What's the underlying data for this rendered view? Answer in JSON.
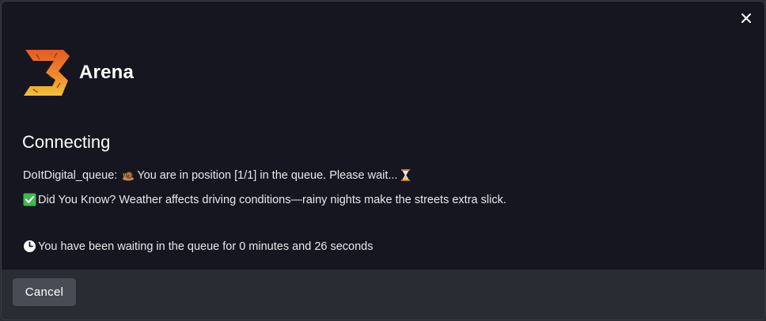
{
  "dialog": {
    "close_icon": "close-icon",
    "brand": {
      "name": "Arena",
      "logo_icon": "arena-logo"
    },
    "status_title": "Connecting",
    "queue_line": {
      "prefix": "DoItDigital_queue:",
      "text": "You are in position [1/1] in the queue. Please wait...",
      "lead_icon": "snail-icon",
      "trail_icon": "hourglass-icon"
    },
    "tip_line": {
      "icon": "check-mark-icon",
      "text": "Did You Know? Weather affects driving conditions—rainy nights make the streets extra slick."
    },
    "wait_line": {
      "icon": "clock-icon",
      "text": "You have been waiting in the queue for 0 minutes and 26 seconds"
    },
    "footer": {
      "cancel_label": "Cancel"
    }
  },
  "colors": {
    "background": "#15161f",
    "footer": "#2a2c34",
    "button": "#4a4c55",
    "logo_orange": "#e8692a",
    "logo_yellow": "#f2b530",
    "check_green": "#3fb950"
  }
}
